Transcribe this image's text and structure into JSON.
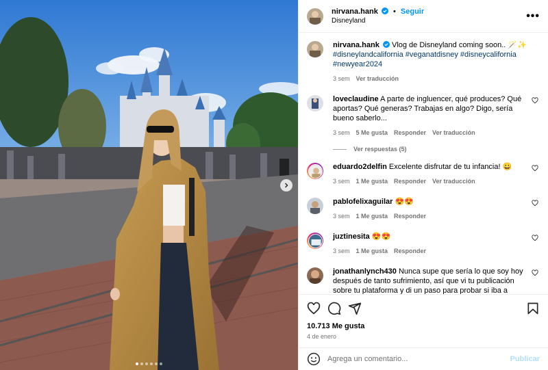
{
  "header": {
    "username": "nirvana.hank",
    "separator": "•",
    "follow_label": "Seguir",
    "location": "Disneyland",
    "more_label": "•••"
  },
  "caption": {
    "username": "nirvana.hank",
    "text": "Vlog de Disneyland coming soon.. 🪄✨",
    "hashtags": [
      "#disneylandcalifornia",
      "#veganatdisney",
      "#disneycalifornia",
      "#newyear2024"
    ],
    "time": "3 sem",
    "translate_label": "Ver traducción"
  },
  "comments": [
    {
      "username": "loveclaudine",
      "text": "A parte de ingluencer, qué produces? Qué aportas? Qué generas? Trabajas en algo? Digo, sería bueno saberlo...",
      "time": "3 sem",
      "likes": "5 Me gusta",
      "reply_label": "Responder",
      "translate_label": "Ver traducción"
    },
    {
      "username": "eduardo2delfin",
      "text": "Excelente disfrutar de tu infancia! 😀",
      "time": "3 sem",
      "likes": "1 Me gusta",
      "reply_label": "Responder",
      "translate_label": "Ver traducción"
    },
    {
      "username": "pablofelixaguilar",
      "text": "😍😍",
      "time": "3 sem",
      "likes": "1 Me gusta",
      "reply_label": "Responder"
    },
    {
      "username": "juztinesita",
      "text": "😍😍",
      "time": "3 sem",
      "likes": "1 Me gusta",
      "reply_label": "Responder"
    },
    {
      "username": "jonathanlynch430",
      "text": "Nunca supe que sería lo que soy hoy después de tanto sufrimiento, así que vi tu publicación sobre tu plataforma y di un paso para probar si iba a funcionar, cambiaste mi vida y ahora estoy muy satisfecho"
    }
  ],
  "view_replies_label": "Ver respuestas (5)",
  "likes_total": "10.713 Me gusta",
  "post_date": "4 de enero",
  "comment_box": {
    "placeholder": "Agrega un comentario...",
    "publish_label": "Publicar"
  },
  "carousel": {
    "slides": 6,
    "current": 1
  },
  "colors": {
    "accent": "#0095f6",
    "hashtag": "#00376b",
    "muted": "#737373",
    "verified": "#0095f6",
    "publish_disabled": "#b2dffc"
  },
  "icons": [
    "verified-badge-icon",
    "heart-icon",
    "comment-icon",
    "share-icon",
    "bookmark-icon",
    "emoji-icon",
    "chevron-right-icon"
  ]
}
